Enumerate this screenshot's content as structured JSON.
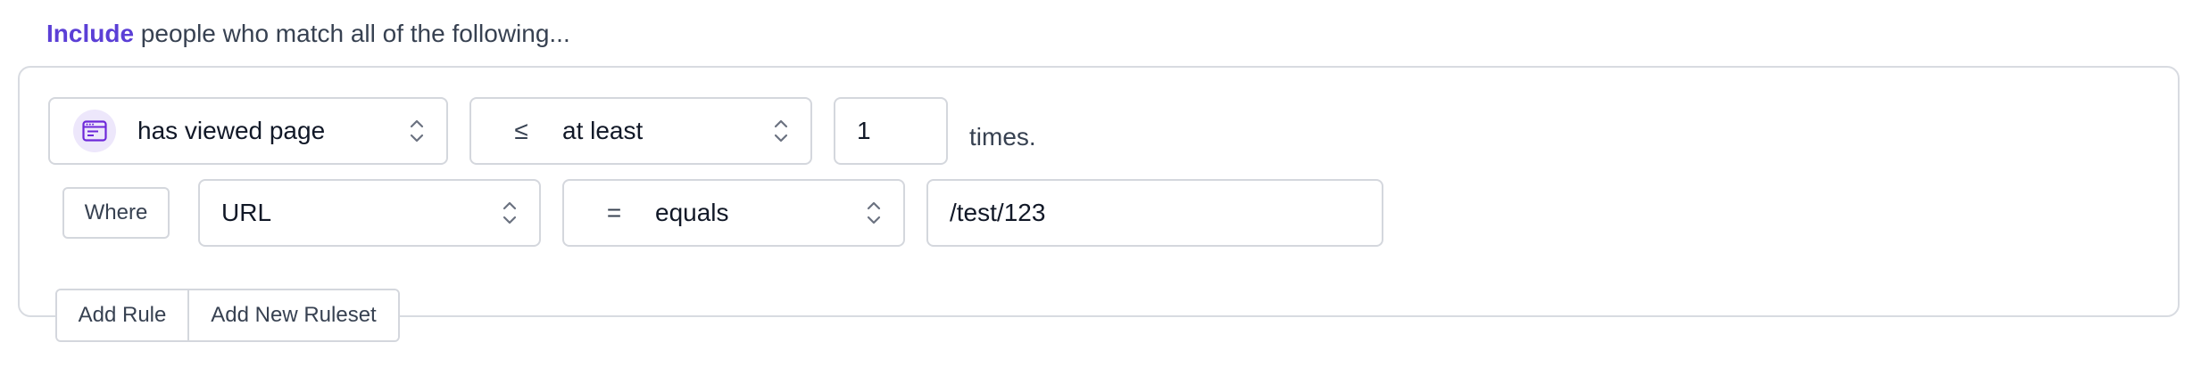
{
  "heading": {
    "emphasis": "Include",
    "rest": " people who match all of the following..."
  },
  "rule": {
    "event_select": {
      "icon": "browser-window-icon",
      "value": "has viewed page"
    },
    "operator_select": {
      "symbol": "≤",
      "value": "at least"
    },
    "count_input": {
      "value": "1"
    },
    "count_suffix": "times."
  },
  "filter": {
    "where_label": "Where",
    "property_select": {
      "value": "URL"
    },
    "comparator_select": {
      "symbol": "=",
      "value": "equals"
    },
    "value_input": {
      "value": "/test/123"
    }
  },
  "actions": {
    "add_rule_label": "Add Rule",
    "add_ruleset_label": "Add New Ruleset"
  },
  "colors": {
    "accent": "#5b3fd6",
    "icon_bg": "#ede7fb",
    "border": "#d4d7dd"
  }
}
